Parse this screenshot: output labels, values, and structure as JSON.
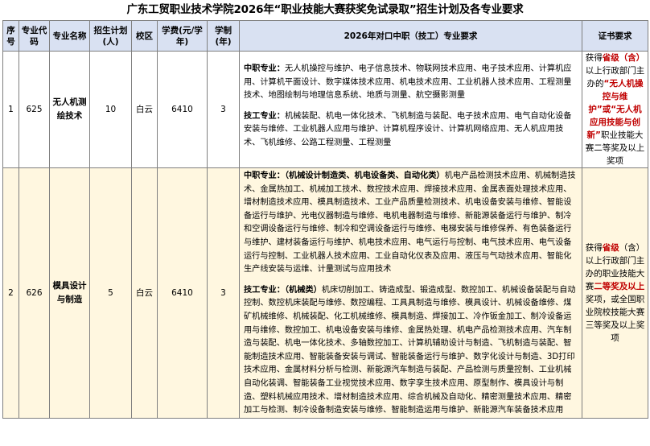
{
  "title": "广东工贸职业技术学院2026年“职业技能大赛获奖免试录取”招生计划及各专业要求",
  "headers": {
    "seq": "序号",
    "code": "专业代码",
    "name": "专业名称",
    "plan": "招生计划(人)",
    "campus": "校区",
    "fee": "学费(元/学年)",
    "years": "学制(年)",
    "req": "2026年对口中职（技工）专业要求",
    "cert": "证书要求"
  },
  "rows": [
    {
      "seq": "1",
      "code": "625",
      "name": "无人机测绘技术",
      "plan": "10",
      "campus": "白云",
      "fee": "6410",
      "years": "3",
      "zz_label": "中职专业：",
      "zz_text": "无人机操控与维护、电子信息技术、物联网技术应用、电子技术应用、计算机应用、计算机平面设计、数字媒体技术应用、机电技术应用、工业机器人技术应用、工程测量技术、地图绘制与地理信息系统、地质与测量、航空摄影测量",
      "jg_label": "技工专业：",
      "jg_text": "机械装配、机电一体化技术、飞机制造与装配、电子技术应用、电气自动化设备安装与维修、工业机器人应用与维护、计算机程序设计、计算机网络应用、无人机应用技术、飞机维修、公路工程测量、工程测量",
      "cert_pre": "获得",
      "cert_hl1": "省级（含）",
      "cert_mid": "以上行政部门主办的",
      "cert_hl2": "“无人机操控与维护”或“无人机应用技能与创新”",
      "cert_post": "职业技能大赛二等奖及以上奖项"
    },
    {
      "seq": "2",
      "code": "626",
      "name": "模具设计与制造",
      "plan": "5",
      "campus": "白云",
      "fee": "6410",
      "years": "3",
      "zz_label": "中职专业：",
      "zz_cat": "（机械设计制造类、机电设备类、自动化类）",
      "zz_text": "机电产品检测技术应用、机械制造技术、金属热加工、机械加工技术、数控技术应用、焊接技术应用、金属表面处理技术应用、增材制造技术应用、模具制造技术、工业产品质量检测技术、机电设备安装与维修、智能设备运行与维护、光电仪器制造与维修、电机电器制造与维修、新能源装备运行与维护、制冷和空调设备运行与维修、制冷和空调设备运行与维修、电梯安装与维修保养、有色装备运行与维护、建材装备运行与维护、机电技术应用、电气运行与控制、电气技术应用、电气设备运行与控制、工业机器人技术应用、工业自动化仪表及应用、液压与气动技术应用、智能化生产线安装与运维、计量测试与应用技术",
      "jg_label": "技工专业：",
      "jg_cat": "（机械类）",
      "jg_text": "机床切削加工、铸造成型、锻造成型、数控加工、机械设备装配与自动控制、数控机床装配与维修、数控编程、工具具制造与维修、模具设计、机械设备维修、煤矿机械维修、机械装配、化工机械维修、模具制造、焊接加工、冷作钣金加工、制冷设备运用与维修、数控加工、机电设备安装与维修、金属热处理、机电产品检测技术应用、汽车制造与装配、机电一体化技术、多轴数控加工、计算机辅助设计与制造、飞机制造与装配、智能制造技术应用、智能装备安装与调试、智能装备运行与维护、数字化设计与制造、3D打印技术应用、金属材料分析与检测、新能源汽车制造与装配、产品检测与质量控制、工业机械自动化装调、智能装备工业视觉技术应用、数字孪生技术应用、原型制作、模具设计与制造、塑料机械应用技术、增材制造技术应用、综合机械及自动化、精密测量技术应用、精密加工与检测、制冷设备制造安装与维修、智能制造运用与维护、新能源汽车装备技术应用",
      "cert_pre": "获得",
      "cert_hl1": "省级",
      "cert_mid": "（含）以上行政部门主办的职业技能大赛",
      "cert_hl2": "二等奖及以上",
      "cert_post": "奖项，或全国职业院校技能大赛三等奖及以上奖项"
    }
  ]
}
